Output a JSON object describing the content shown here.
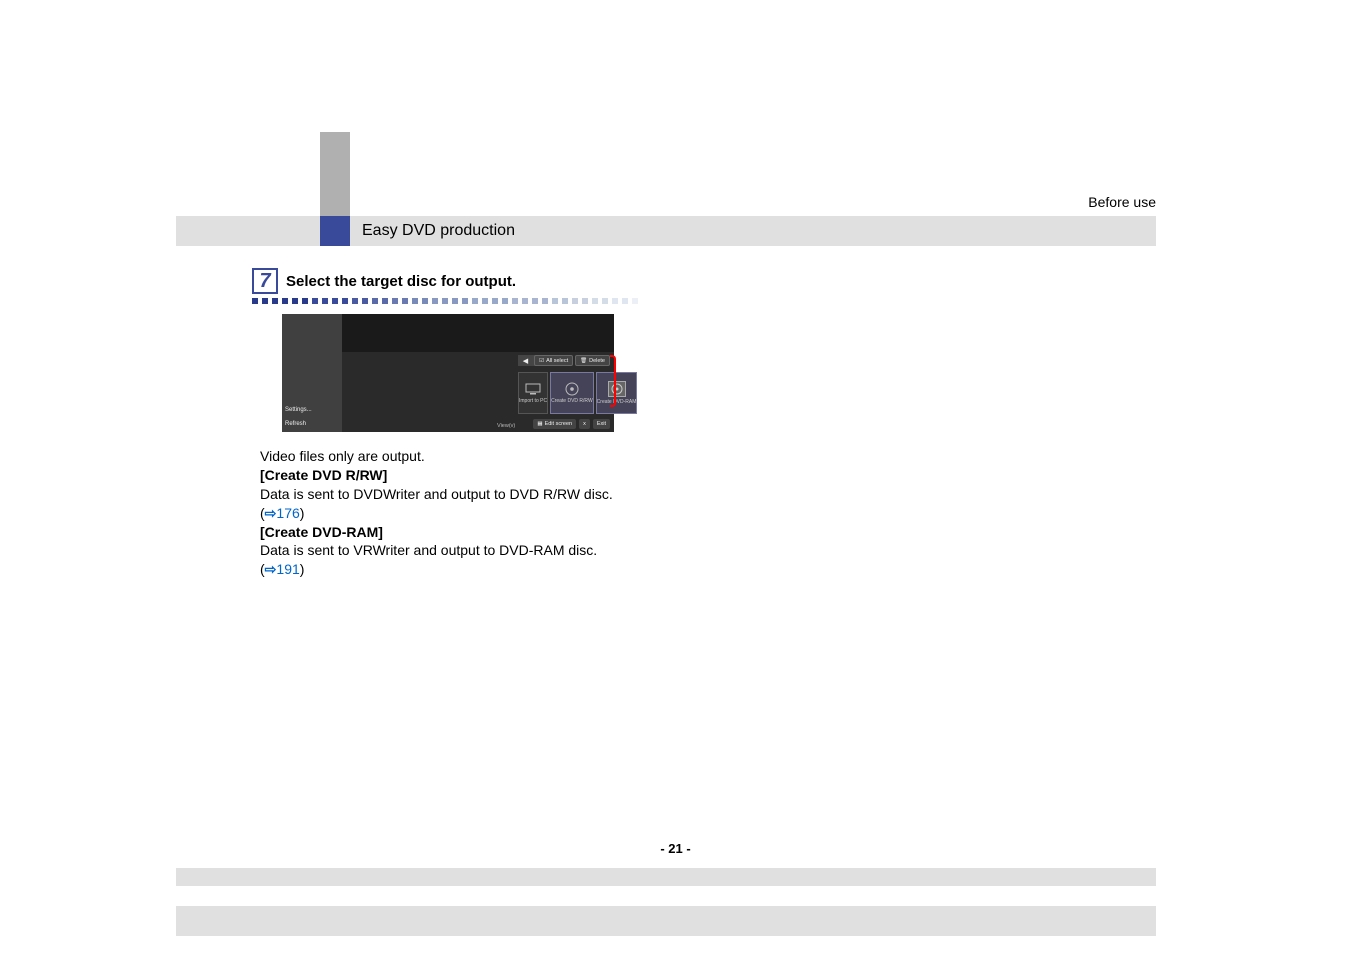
{
  "doc": {
    "breadcrumb": "Before use",
    "section_header": "Easy DVD production",
    "step_number": "7",
    "step_title": "Select the target disc for output.",
    "body_intro": "Video files only are output.",
    "create1_label": "[Create DVD R/RW]",
    "create1_desc_prefix": "Data is sent to DVDWriter and output to DVD R/RW disc. (",
    "create1_link": "176",
    "create1_desc_suffix": ")",
    "create2_label": "[Create DVD-RAM]",
    "create2_desc_prefix": "Data is sent to VRWriter and output to DVD-RAM disc. (",
    "create2_link": "191",
    "create2_desc_suffix": ")",
    "page_number": "- 21 -"
  },
  "ss": {
    "settings": "Settings...",
    "refresh": "Refresh",
    "view": "View(v)",
    "arrow_left": "◀",
    "arrow_right": "▶",
    "all_select": "All select",
    "delete": "Delete",
    "btn1": "Import to PC",
    "btn2": "Create DVD R/RW",
    "btn3": "Create DVD-RAM",
    "edit_screen": "Edit screen",
    "exit": "Exit",
    "x_label": "x"
  }
}
